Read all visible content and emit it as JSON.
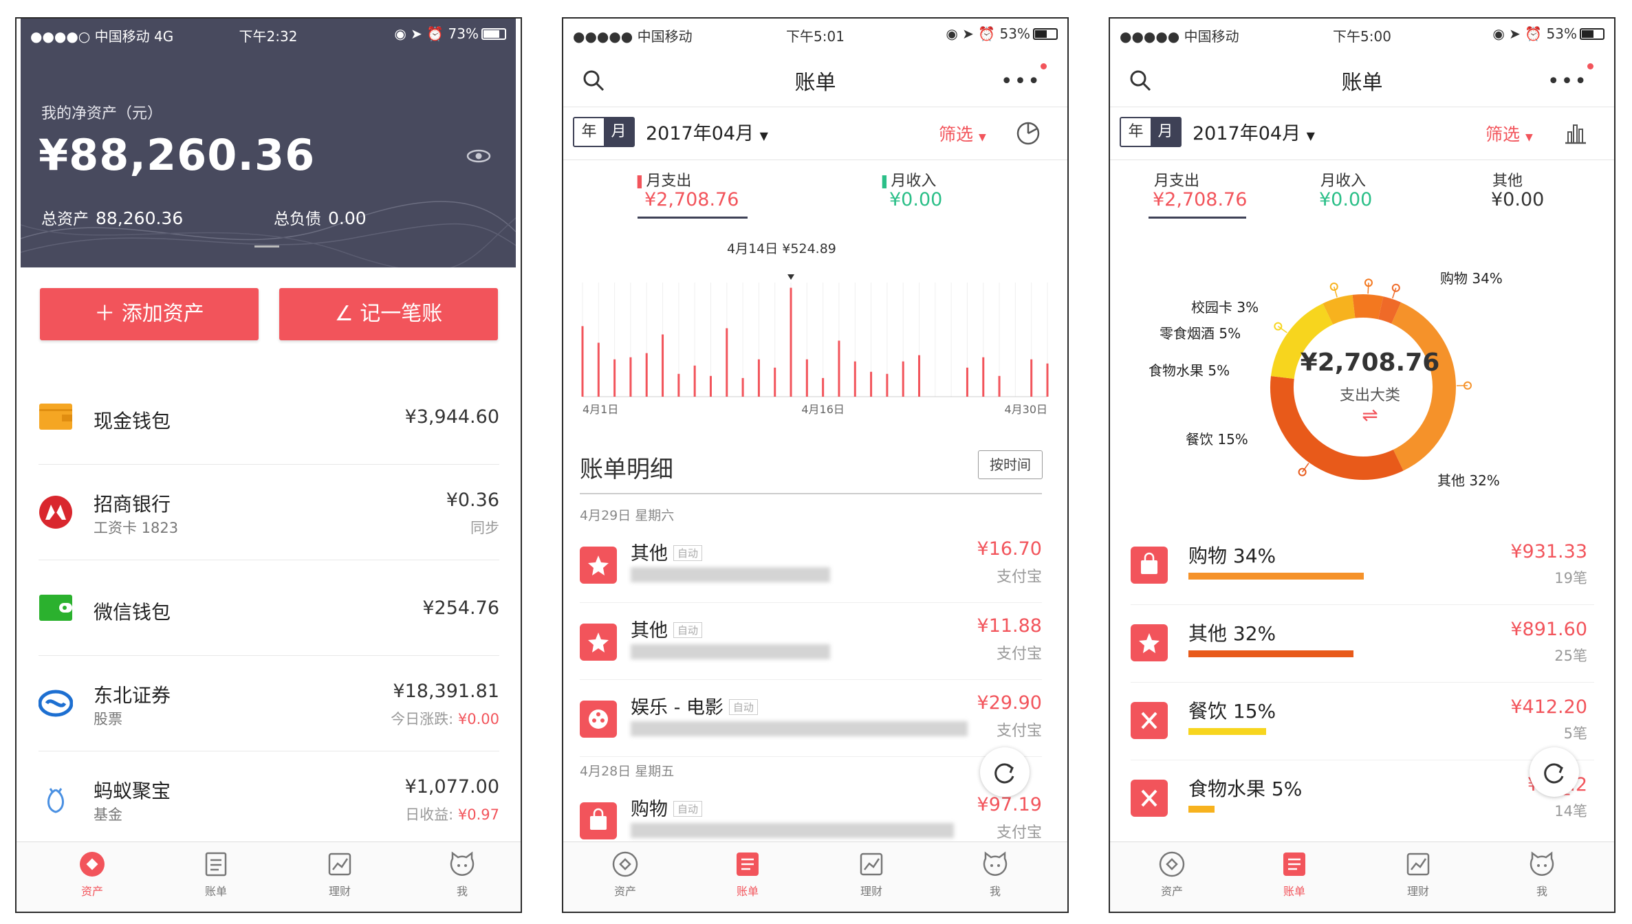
{
  "phone1": {
    "status": {
      "carrier": "●●●●○ 中国移动  4G",
      "time": "下午2:32",
      "battery": "73%",
      "battery_level": 0.73
    },
    "net_label": "我的净资产（元）",
    "net_value": "¥88,260.36",
    "total_assets_label": "总资产",
    "total_assets": "88,260.36",
    "total_debt_label": "总负债",
    "total_debt": "0.00",
    "add_asset": "＋ 添加资产",
    "record": "∠ 记一笔账",
    "accounts": [
      {
        "name": "现金钱包",
        "sub": "",
        "amount": "¥3,944.60",
        "extra_label": "",
        "extra_value": ""
      },
      {
        "name": "招商银行",
        "sub": "工资卡 1823",
        "amount": "¥0.36",
        "extra_label": "同步",
        "extra_value": ""
      },
      {
        "name": "微信钱包",
        "sub": "",
        "amount": "¥254.76",
        "extra_label": "",
        "extra_value": ""
      },
      {
        "name": "东北证券",
        "sub": "股票",
        "amount": "¥18,391.81",
        "extra_label": "今日涨跌: ",
        "extra_value": "¥0.00"
      },
      {
        "name": "蚂蚁聚宝",
        "sub": "基金",
        "amount": "¥1,077.00",
        "extra_label": "日收益: ",
        "extra_value": "¥0.97"
      }
    ],
    "tabs": [
      "资产",
      "账单",
      "理财",
      "我"
    ]
  },
  "phone2": {
    "status": {
      "carrier": "●●●●● 中国移动",
      "time": "下午5:01",
      "battery": "53%",
      "battery_level": 0.53
    },
    "title": "账单",
    "year": "年",
    "month": "月",
    "period": "2017年04月",
    "filter": "筛选",
    "expense_label": "月支出",
    "expense": "¥2,708.76",
    "income_label": "月收入",
    "income": "¥0.00",
    "chart_data": {
      "type": "bar",
      "title": "",
      "annotation": "4月14日 ¥524.89",
      "x_labels": [
        "4月1日",
        "4月16日",
        "4月30日"
      ],
      "days": [
        1,
        2,
        3,
        4,
        5,
        6,
        7,
        8,
        9,
        10,
        11,
        12,
        13,
        14,
        15,
        16,
        17,
        18,
        19,
        20,
        21,
        22,
        23,
        24,
        25,
        26,
        27,
        28,
        29,
        30
      ],
      "values": [
        340,
        260,
        180,
        190,
        210,
        300,
        110,
        150,
        100,
        330,
        90,
        180,
        140,
        524.89,
        180,
        90,
        270,
        170,
        120,
        110,
        170,
        200,
        0,
        0,
        140,
        190,
        100,
        0,
        180,
        160
      ],
      "ymax": 550,
      "color": "#f2545b"
    },
    "detail_title": "账单明细",
    "sort": "按时间",
    "groups": [
      {
        "date": "4月29日 星期六",
        "rows": [
          {
            "name": "其他",
            "tag": "自动",
            "amount": "¥16.70",
            "source": "支付宝"
          },
          {
            "name": "其他",
            "tag": "自动",
            "amount": "¥11.88",
            "source": "支付宝"
          },
          {
            "name": "娱乐 - 电影",
            "tag": "自动",
            "amount": "¥29.90",
            "source": "支付宝"
          }
        ]
      },
      {
        "date": "4月28日 星期五",
        "rows": [
          {
            "name": "购物",
            "tag": "自动",
            "amount": "¥97.19",
            "source": "支付宝"
          }
        ]
      }
    ],
    "tabs": [
      "资产",
      "账单",
      "理财",
      "我"
    ]
  },
  "phone3": {
    "status": {
      "carrier": "●●●●● 中国移动",
      "time": "下午5:00",
      "battery": "53%",
      "battery_level": 0.53
    },
    "title": "账单",
    "year": "年",
    "month": "月",
    "period": "2017年04月",
    "filter": "筛选",
    "expense_label": "月支出",
    "expense": "¥2,708.76",
    "income_label": "月收入",
    "income": "¥0.00",
    "other_label": "其他",
    "other": "¥0.00",
    "donut_center": "¥2,708.76",
    "donut_sub": "支出大类",
    "chart_data": {
      "type": "pie",
      "title": "",
      "slices": [
        {
          "label": "购物 34%",
          "value": 34,
          "color": "#f5922a"
        },
        {
          "label": "其他 32%",
          "value": 32,
          "color": "#e85a1a"
        },
        {
          "label": "餐饮 15%",
          "value": 15,
          "color": "#f7d51e"
        },
        {
          "label": "食物水果 5%",
          "value": 5,
          "color": "#f7b21e"
        },
        {
          "label": "零食烟酒 5%",
          "value": 5,
          "color": "#f3781f"
        },
        {
          "label": "校园卡 3%",
          "value": 3,
          "color": "#ef6a28"
        }
      ]
    },
    "categories": [
      {
        "name": "购物 34%",
        "amount": "¥931.33",
        "count": "19笔",
        "fill": 0.34,
        "color": "#f5922a"
      },
      {
        "name": "其他 32%",
        "amount": "¥891.60",
        "count": "25笔",
        "fill": 0.32,
        "color": "#e85a1a"
      },
      {
        "name": "餐饮 15%",
        "amount": "¥412.20",
        "count": "5笔",
        "fill": 0.15,
        "color": "#f7d51e"
      },
      {
        "name": "食物水果 5%",
        "amount": "¥1__.2",
        "count": "14笔",
        "fill": 0.05,
        "color": "#f7b21e"
      }
    ],
    "tabs": [
      "资产",
      "账单",
      "理财",
      "我"
    ]
  }
}
